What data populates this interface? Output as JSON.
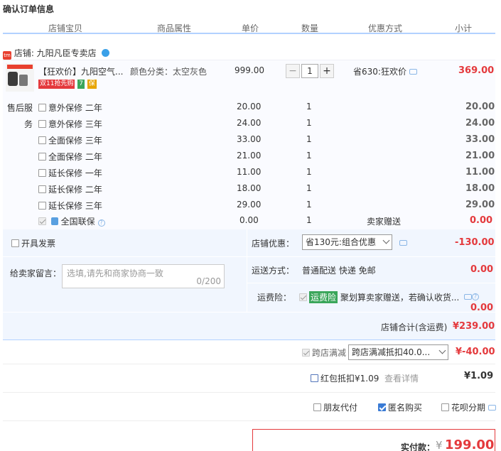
{
  "page_title": "确认订单信息",
  "columns": [
    "店铺宝贝",
    "商品属性",
    "单价",
    "数量",
    "优惠方式",
    "小计"
  ],
  "shop": {
    "badge": "tm",
    "label": "店铺: 九阳凡臣专卖店"
  },
  "item": {
    "title": "【狂欢价】九阳空气...",
    "tags": [
      "双11抢先购",
      "7",
      "保"
    ],
    "attribute": "颜色分类：太空灰色",
    "price": "999.00",
    "quantity": "1",
    "qty_minus": "−",
    "qty_plus": "+",
    "discount": "省630:狂欢价",
    "subtotal": "369.00"
  },
  "services": {
    "label_line1": "售后服",
    "label_line2": "务",
    "rows": [
      {
        "name": "意外保修 二年",
        "price": "20.00",
        "qty": "1",
        "subtotal": "20.00"
      },
      {
        "name": "意外保修 三年",
        "price": "24.00",
        "qty": "1",
        "subtotal": "24.00"
      },
      {
        "name": "全面保修 三年",
        "price": "33.00",
        "qty": "1",
        "subtotal": "33.00"
      },
      {
        "name": "全面保修 二年",
        "price": "21.00",
        "qty": "1",
        "subtotal": "21.00"
      },
      {
        "name": "延长保修 一年",
        "price": "11.00",
        "qty": "1",
        "subtotal": "11.00"
      },
      {
        "name": "延长保修 二年",
        "price": "18.00",
        "qty": "1",
        "subtotal": "18.00"
      },
      {
        "name": "延长保修 三年",
        "price": "29.00",
        "qty": "1",
        "subtotal": "29.00"
      }
    ],
    "gift": {
      "name": "全国联保",
      "price": "0.00",
      "qty": "1",
      "discount": "卖家赠送",
      "subtotal": "0.00"
    }
  },
  "invoice_label": "开具发票",
  "message": {
    "label": "给卖家留言：",
    "placeholder": "选填,请先和商家协商一致",
    "count": "0/200"
  },
  "shop_discount": {
    "label": "店铺优惠：",
    "selected": "省130元:组合优惠",
    "amount": "-130.00"
  },
  "shipping": {
    "label": "运送方式：",
    "value": "普通配送 快递 免邮",
    "amount": "0.00"
  },
  "insurance": {
    "label": "运费险：",
    "tag": "运费险",
    "text": "聚划算卖家赠送，若确认收货...",
    "amount": "0.00"
  },
  "shop_total": {
    "label": "店铺合计(含运费)",
    "amount": "¥239.00"
  },
  "cross_store": {
    "label": "跨店满减",
    "selected": "跨店满减抵扣40.0...",
    "amount": "¥-40.00"
  },
  "red_packet": {
    "label": "红包抵扣¥1.09",
    "link": "查看详情",
    "amount": "¥1.09"
  },
  "options": {
    "friend_pay": "朋友代付",
    "anonymous": "匿名购买",
    "huabei": "花呗分期"
  },
  "final": {
    "label": "实付款：",
    "currency": "¥",
    "amount": "199.00"
  },
  "colors": {
    "accent_red": "#e4393c",
    "header_border": "#b2d1ff",
    "panel_bg": "#f1f6fe",
    "link_blue": "#3a7bd5"
  }
}
